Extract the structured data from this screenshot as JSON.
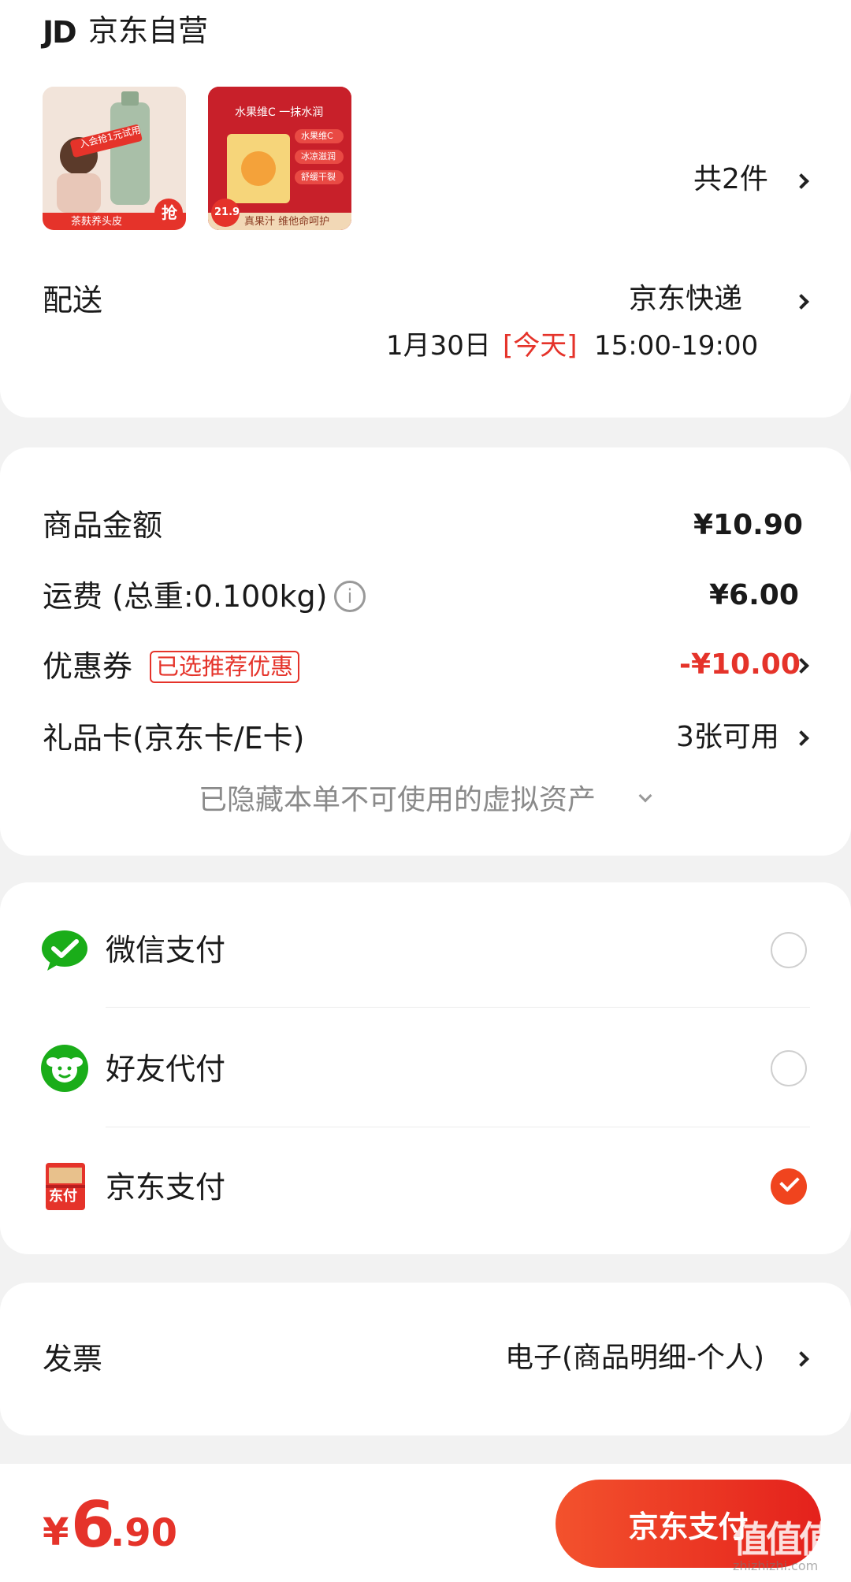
{
  "shop": {
    "logo": "JD",
    "name": "京东自营"
  },
  "products": {
    "thumb1": {
      "badge": "入会抢1元试用",
      "caption": "茶麸养头皮",
      "grab": "抢"
    },
    "thumb2": {
      "headline": "水果维C 一抹水润",
      "tags": [
        "水果维C",
        "冰凉滋润",
        "舒缓干裂"
      ],
      "price": "21.9",
      "caption": "真果汁 维他命呵护"
    },
    "count_label": "共2件"
  },
  "delivery": {
    "label": "配送",
    "method": "京东快递",
    "date": "1月30日",
    "today": "[今天]",
    "time": "15:00-19:00"
  },
  "fees": {
    "goods_label": "商品金额",
    "goods_value": "¥10.90",
    "shipping_label": "运费 (总重:0.100kg)",
    "shipping_value": "¥6.00",
    "coupon_label": "优惠券",
    "coupon_tag": "已选推荐优惠",
    "coupon_value": "-¥10.00",
    "giftcard_label": "礼品卡(京东卡/E卡)",
    "giftcard_value": "3张可用",
    "hidden_assets": "已隐藏本单不可使用的虚拟资产"
  },
  "payment": {
    "wechat": "微信支付",
    "friend": "好友代付",
    "jd": "京东支付",
    "jd_icon_text": "东付",
    "selected": "jd"
  },
  "invoice": {
    "label": "发票",
    "value": "电子(商品明细-个人)"
  },
  "footer": {
    "currency": "¥",
    "amount_int": "6",
    "amount_dec": ".90",
    "pay_button": "京东支付",
    "watermark": "值值值",
    "watermark_url": "zhizhizhi.com"
  },
  "colors": {
    "accent": "#e5332a",
    "wechat_green": "#1aad19",
    "pay_red": "#f0441e"
  }
}
